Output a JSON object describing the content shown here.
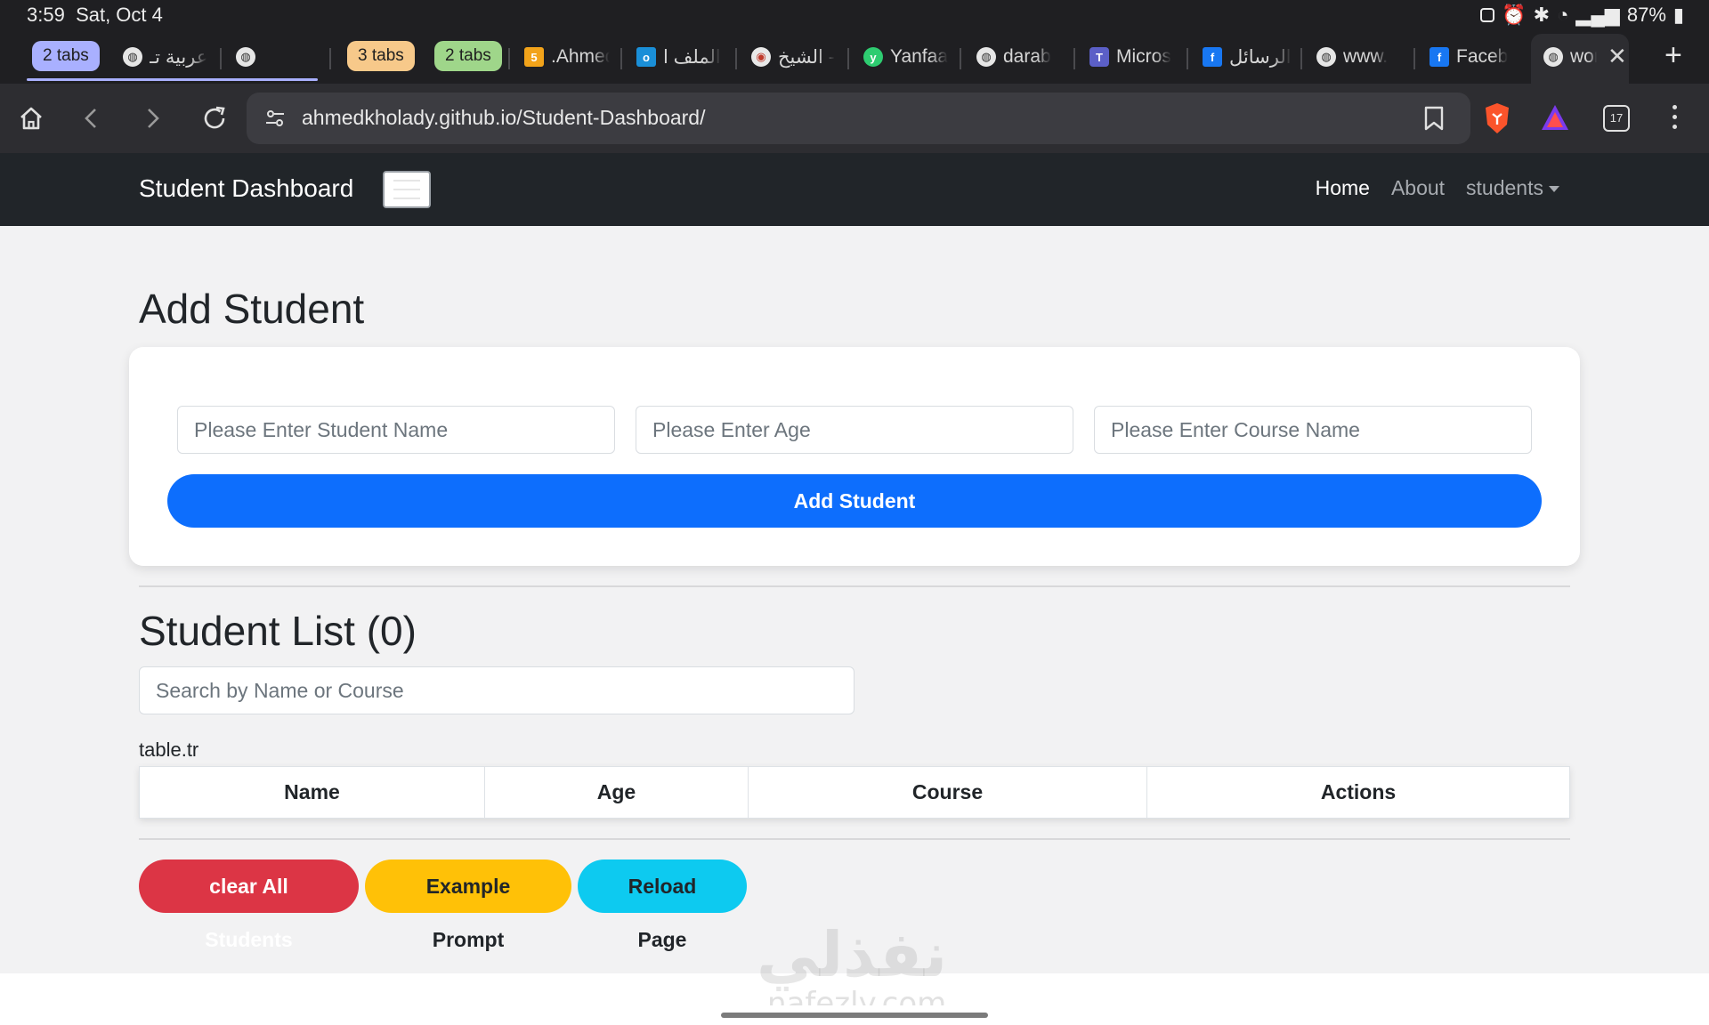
{
  "status_bar": {
    "time": "3:59",
    "date": "Sat, Oct 4",
    "battery": "87%"
  },
  "tabs": {
    "groups": [
      {
        "label": "2 tabs",
        "color": "#a9b0ff"
      },
      {
        "label": "3 tabs",
        "color": "#f7c98a"
      },
      {
        "label": "2 tabs",
        "color": "#9fd68a"
      }
    ],
    "items": [
      {
        "title": "عربية تـ",
        "icon": "globe-icon"
      },
      {
        "title": "",
        "icon": "globe-icon"
      },
      {
        "title": ".Ahmed",
        "icon": "html5-icon"
      },
      {
        "title": "الملف ا",
        "icon": "outlook-icon"
      },
      {
        "title": "الشيخ -",
        "icon": "brave-icon"
      },
      {
        "title": "Yanfaa",
        "icon": "yanfaa-icon"
      },
      {
        "title": "darab",
        "icon": "globe-icon"
      },
      {
        "title": "Micros",
        "icon": "teams-icon"
      },
      {
        "title": "الرسائل",
        "icon": "facebook-icon"
      },
      {
        "title": "www.",
        "icon": "globe-icon"
      },
      {
        "title": "Faceb",
        "icon": "facebook-icon"
      },
      {
        "title": "wor",
        "icon": "globe-icon"
      }
    ],
    "tab_count": "17"
  },
  "toolbar": {
    "url": "ahmedkholady.github.io/Student-Dashboard/"
  },
  "navbar": {
    "brand": "Student Dashboard",
    "links": {
      "home": "Home",
      "about": "About",
      "students": "students"
    }
  },
  "add_form": {
    "title": "Add Student",
    "name_placeholder": "Please Enter Student Name",
    "age_placeholder": "Please Enter Age",
    "course_placeholder": "Please Enter Course Name",
    "submit_label": "Add Student"
  },
  "student_list": {
    "title": "Student List (0)",
    "search_placeholder": "Search by Name or Course",
    "caption": "table.tr",
    "columns": [
      "Name",
      "Age",
      "Course",
      "Actions"
    ]
  },
  "actions": {
    "clear_label": "clear All Students",
    "example_label": "Example Prompt",
    "reload_label": "Reload Page"
  },
  "colors": {
    "primary": "#0d6efd",
    "danger": "#dc3545",
    "warning": "#ffc107",
    "info": "#0dcaf0",
    "navbar": "#212529"
  },
  "watermark": {
    "arabic": "نفذلي",
    "site": "nafezly.com"
  }
}
